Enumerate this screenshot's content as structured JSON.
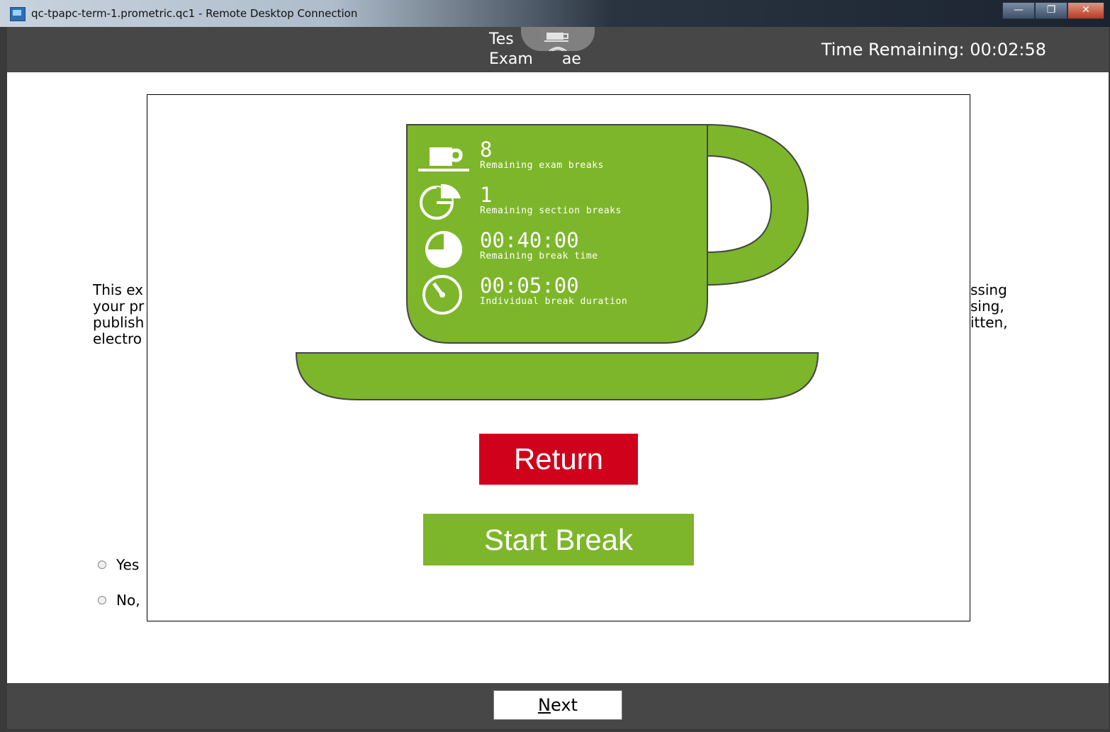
{
  "window": {
    "title": "qc-tpapc-term-1.prometric.qc1 - Remote Desktop Connection",
    "controls": {
      "minimize": "—",
      "maximize": "❐",
      "close": "✕"
    }
  },
  "header": {
    "title_line1": "Tes",
    "title_line2": "Exam  ",
    "title_line2_suffix": "ae",
    "time_remaining": "Time Remaining: 00:02:58"
  },
  "background": {
    "left_lines": [
      "This ex",
      "your pr",
      "publish",
      "electro"
    ],
    "right_lines": [
      "ssing",
      "sing,",
      "itten,",
      ""
    ],
    "options": [
      "Yes",
      "No,"
    ]
  },
  "break_panel": {
    "stats": [
      {
        "icon": "cup-icon",
        "value": "8",
        "label": "Remaining exam breaks"
      },
      {
        "icon": "pie-chart-icon",
        "value": "1",
        "label": "Remaining section breaks"
      },
      {
        "icon": "clock-icon",
        "value": "00:40:00",
        "label": "Remaining break time"
      },
      {
        "icon": "stopwatch-icon",
        "value": "00:05:00",
        "label": "Individual break duration"
      }
    ],
    "return_label": "Return",
    "start_break_label": "Start Break"
  },
  "footer": {
    "next_label_underlined": "N",
    "next_label_rest": "ext"
  },
  "colors": {
    "accent_green": "#7db62a",
    "return_red": "#d0021b",
    "header_gray": "#474747"
  }
}
